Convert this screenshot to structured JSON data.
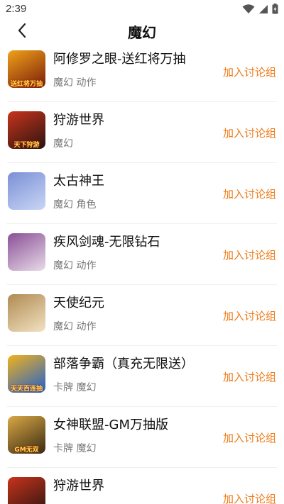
{
  "status_bar": {
    "time": "2:39",
    "icons": [
      "wifi-icon",
      "cellular-icon",
      "battery-icon"
    ]
  },
  "header": {
    "title": "魔幻",
    "back_icon": "back-arrow-icon"
  },
  "colors": {
    "accent": "#ee7b18",
    "tag_text": "#777777",
    "divider": "#f0f0f0"
  },
  "games": [
    {
      "name": "阿修罗之眼-送红将万抽",
      "tags": "魔幻 动作",
      "action": "加入讨论组",
      "icon_caption": "送红将万抽",
      "icon_colors": [
        "#7a1c0a",
        "#f0a21a"
      ]
    },
    {
      "name": "狩游世界",
      "tags": "魔幻",
      "action": "加入讨论组",
      "icon_caption": "天下狩游",
      "icon_colors": [
        "#2a1410",
        "#c8341c"
      ]
    },
    {
      "name": "太古神王",
      "tags": "魔幻 角色",
      "action": "加入讨论组",
      "icon_caption": "",
      "icon_colors": [
        "#c9d6f5",
        "#7b8fd6"
      ]
    },
    {
      "name": "疾风剑魂-无限钻石",
      "tags": "魔幻 动作",
      "action": "加入讨论组",
      "icon_caption": "",
      "icon_colors": [
        "#e8dbe8",
        "#8a4f96"
      ]
    },
    {
      "name": "天使纪元",
      "tags": "魔幻 动作",
      "action": "加入讨论组",
      "icon_caption": "",
      "icon_colors": [
        "#f2e2c2",
        "#b08a52"
      ]
    },
    {
      "name": "部落争霸（真充无限送）",
      "tags": "卡牌 魔幻",
      "action": "加入讨论组",
      "icon_caption": "天天百连抽",
      "icon_colors": [
        "#1f5fcf",
        "#f2b21c"
      ]
    },
    {
      "name": "女神联盟-GM万抽版",
      "tags": "卡牌 魔幻",
      "action": "加入讨论组",
      "icon_caption": "GM无双",
      "icon_colors": [
        "#3a2a12",
        "#d9a845"
      ]
    },
    {
      "name": "狩游世界",
      "tags": "",
      "action": "加入讨论组",
      "icon_caption": "",
      "icon_colors": [
        "#2a1410",
        "#c8341c"
      ]
    }
  ]
}
